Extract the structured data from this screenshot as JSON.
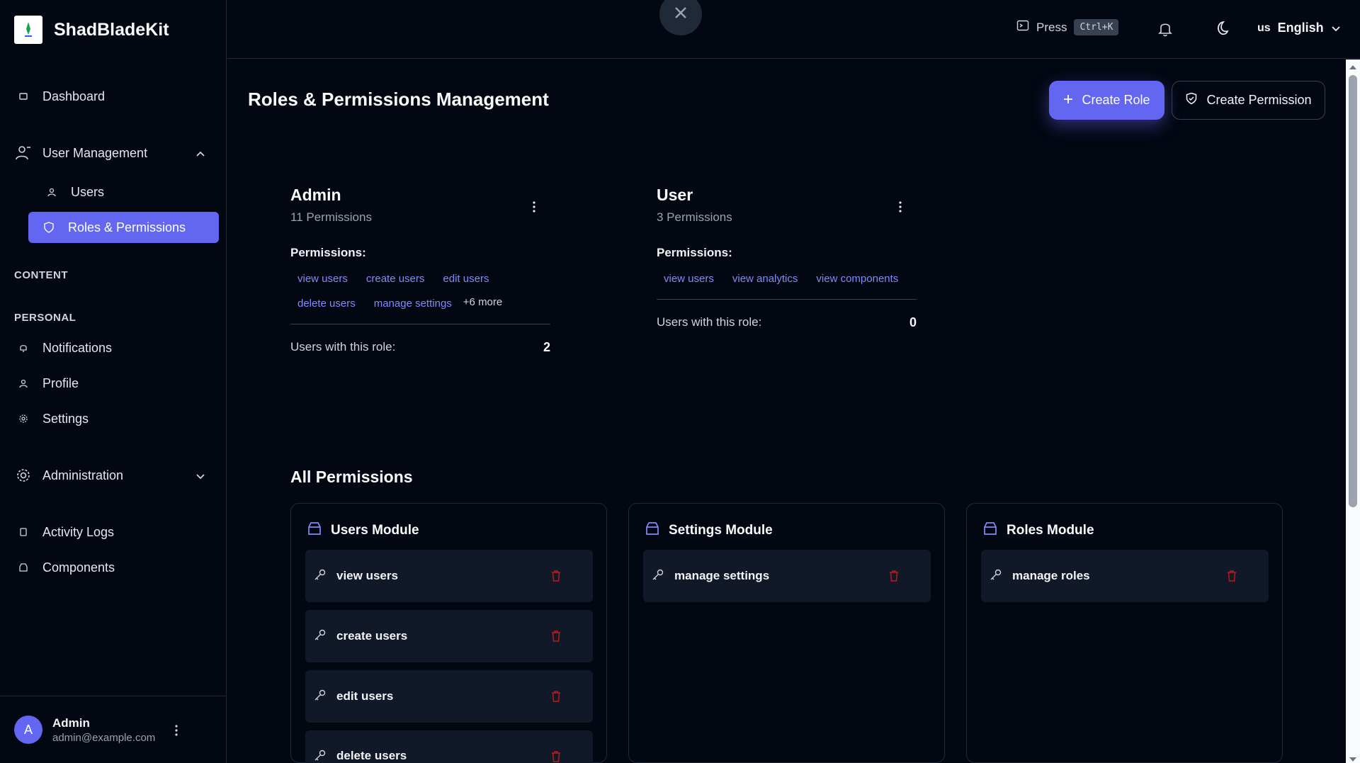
{
  "brand": {
    "name": "ShadBladeKit"
  },
  "sidebar": {
    "dashboard": "Dashboard",
    "user_management": "User Management",
    "users": "Users",
    "roles_permissions": "Roles & Permissions",
    "content_label": "CONTENT",
    "personal_label": "PERSONAL",
    "notifications": "Notifications",
    "profile": "Profile",
    "settings": "Settings",
    "administration": "Administration",
    "activity_logs": "Activity Logs",
    "components": "Components"
  },
  "user": {
    "initial": "A",
    "name": "Admin",
    "email": "admin@example.com"
  },
  "header": {
    "press": "Press",
    "shortcut": "Ctrl+K",
    "lang_code": "us",
    "language": "English"
  },
  "page": {
    "title": "Roles & Permissions Management",
    "create_role": "Create Role",
    "create_permission": "Create Permission"
  },
  "roles": [
    {
      "name": "Admin",
      "count": "11 Permissions",
      "permissions_label": "Permissions:",
      "chips": [
        "view users",
        "create users",
        "edit users",
        "delete users",
        "manage settings"
      ],
      "more": "+6 more",
      "users_label": "Users with this role:",
      "users_count": "2"
    },
    {
      "name": "User",
      "count": "3 Permissions",
      "permissions_label": "Permissions:",
      "chips": [
        "view users",
        "view analytics",
        "view components"
      ],
      "users_label": "Users with this role:",
      "users_count": "0"
    }
  ],
  "all_permissions": {
    "title": "All Permissions",
    "modules": [
      {
        "name": "Users Module",
        "items": [
          "view users",
          "create users",
          "edit users",
          "delete users"
        ]
      },
      {
        "name": "Settings Module",
        "items": [
          "manage settings"
        ]
      },
      {
        "name": "Roles Module",
        "items": [
          "manage roles"
        ]
      }
    ]
  },
  "colors": {
    "accent": "#6366f1",
    "chip": "#818cf8",
    "danger": "#b91c1c",
    "background": "#030712"
  }
}
